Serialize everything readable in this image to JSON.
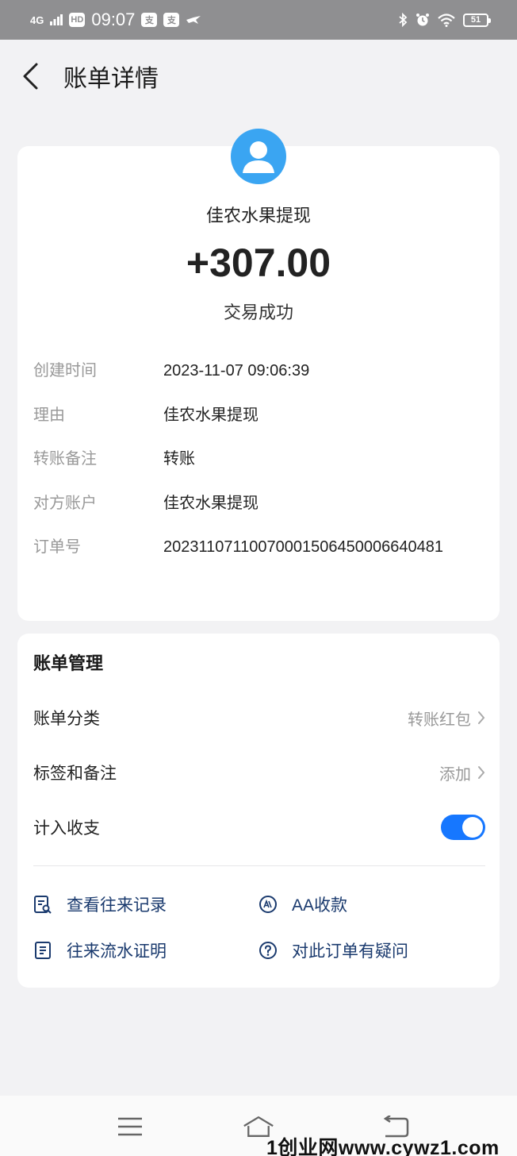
{
  "status_bar": {
    "network": "4G",
    "hd": "HD",
    "time": "09:07",
    "app_icon_text": "支",
    "battery": "51"
  },
  "header": {
    "title": "账单详情"
  },
  "transaction": {
    "payee": "佳农水果提现",
    "amount": "+307.00",
    "status": "交易成功",
    "details": [
      {
        "label": "创建时间",
        "value": "2023-11-07 09:06:39"
      },
      {
        "label": "理由",
        "value": "佳农水果提现"
      },
      {
        "label": "转账备注",
        "value": "转账"
      },
      {
        "label": "对方账户",
        "value": "佳农水果提现"
      },
      {
        "label": "订单号",
        "value": "20231107110070001506450006640481"
      }
    ]
  },
  "manage": {
    "title": "账单管理",
    "category": {
      "label": "账单分类",
      "value": "转账红包"
    },
    "tags": {
      "label": "标签和备注",
      "value": "添加"
    },
    "include": {
      "label": "计入收支",
      "enabled": true
    },
    "links": [
      {
        "label": "查看往来记录",
        "icon": "record-search-icon"
      },
      {
        "label": "AA收款",
        "icon": "aa-icon"
      },
      {
        "label": "往来流水证明",
        "icon": "statement-icon"
      },
      {
        "label": "对此订单有疑问",
        "icon": "question-icon"
      }
    ]
  },
  "watermark": "1创业网www.cywz1.com",
  "colors": {
    "accent": "#1677ff",
    "avatar": "#3aa5f2",
    "link": "#1a3a6e"
  }
}
